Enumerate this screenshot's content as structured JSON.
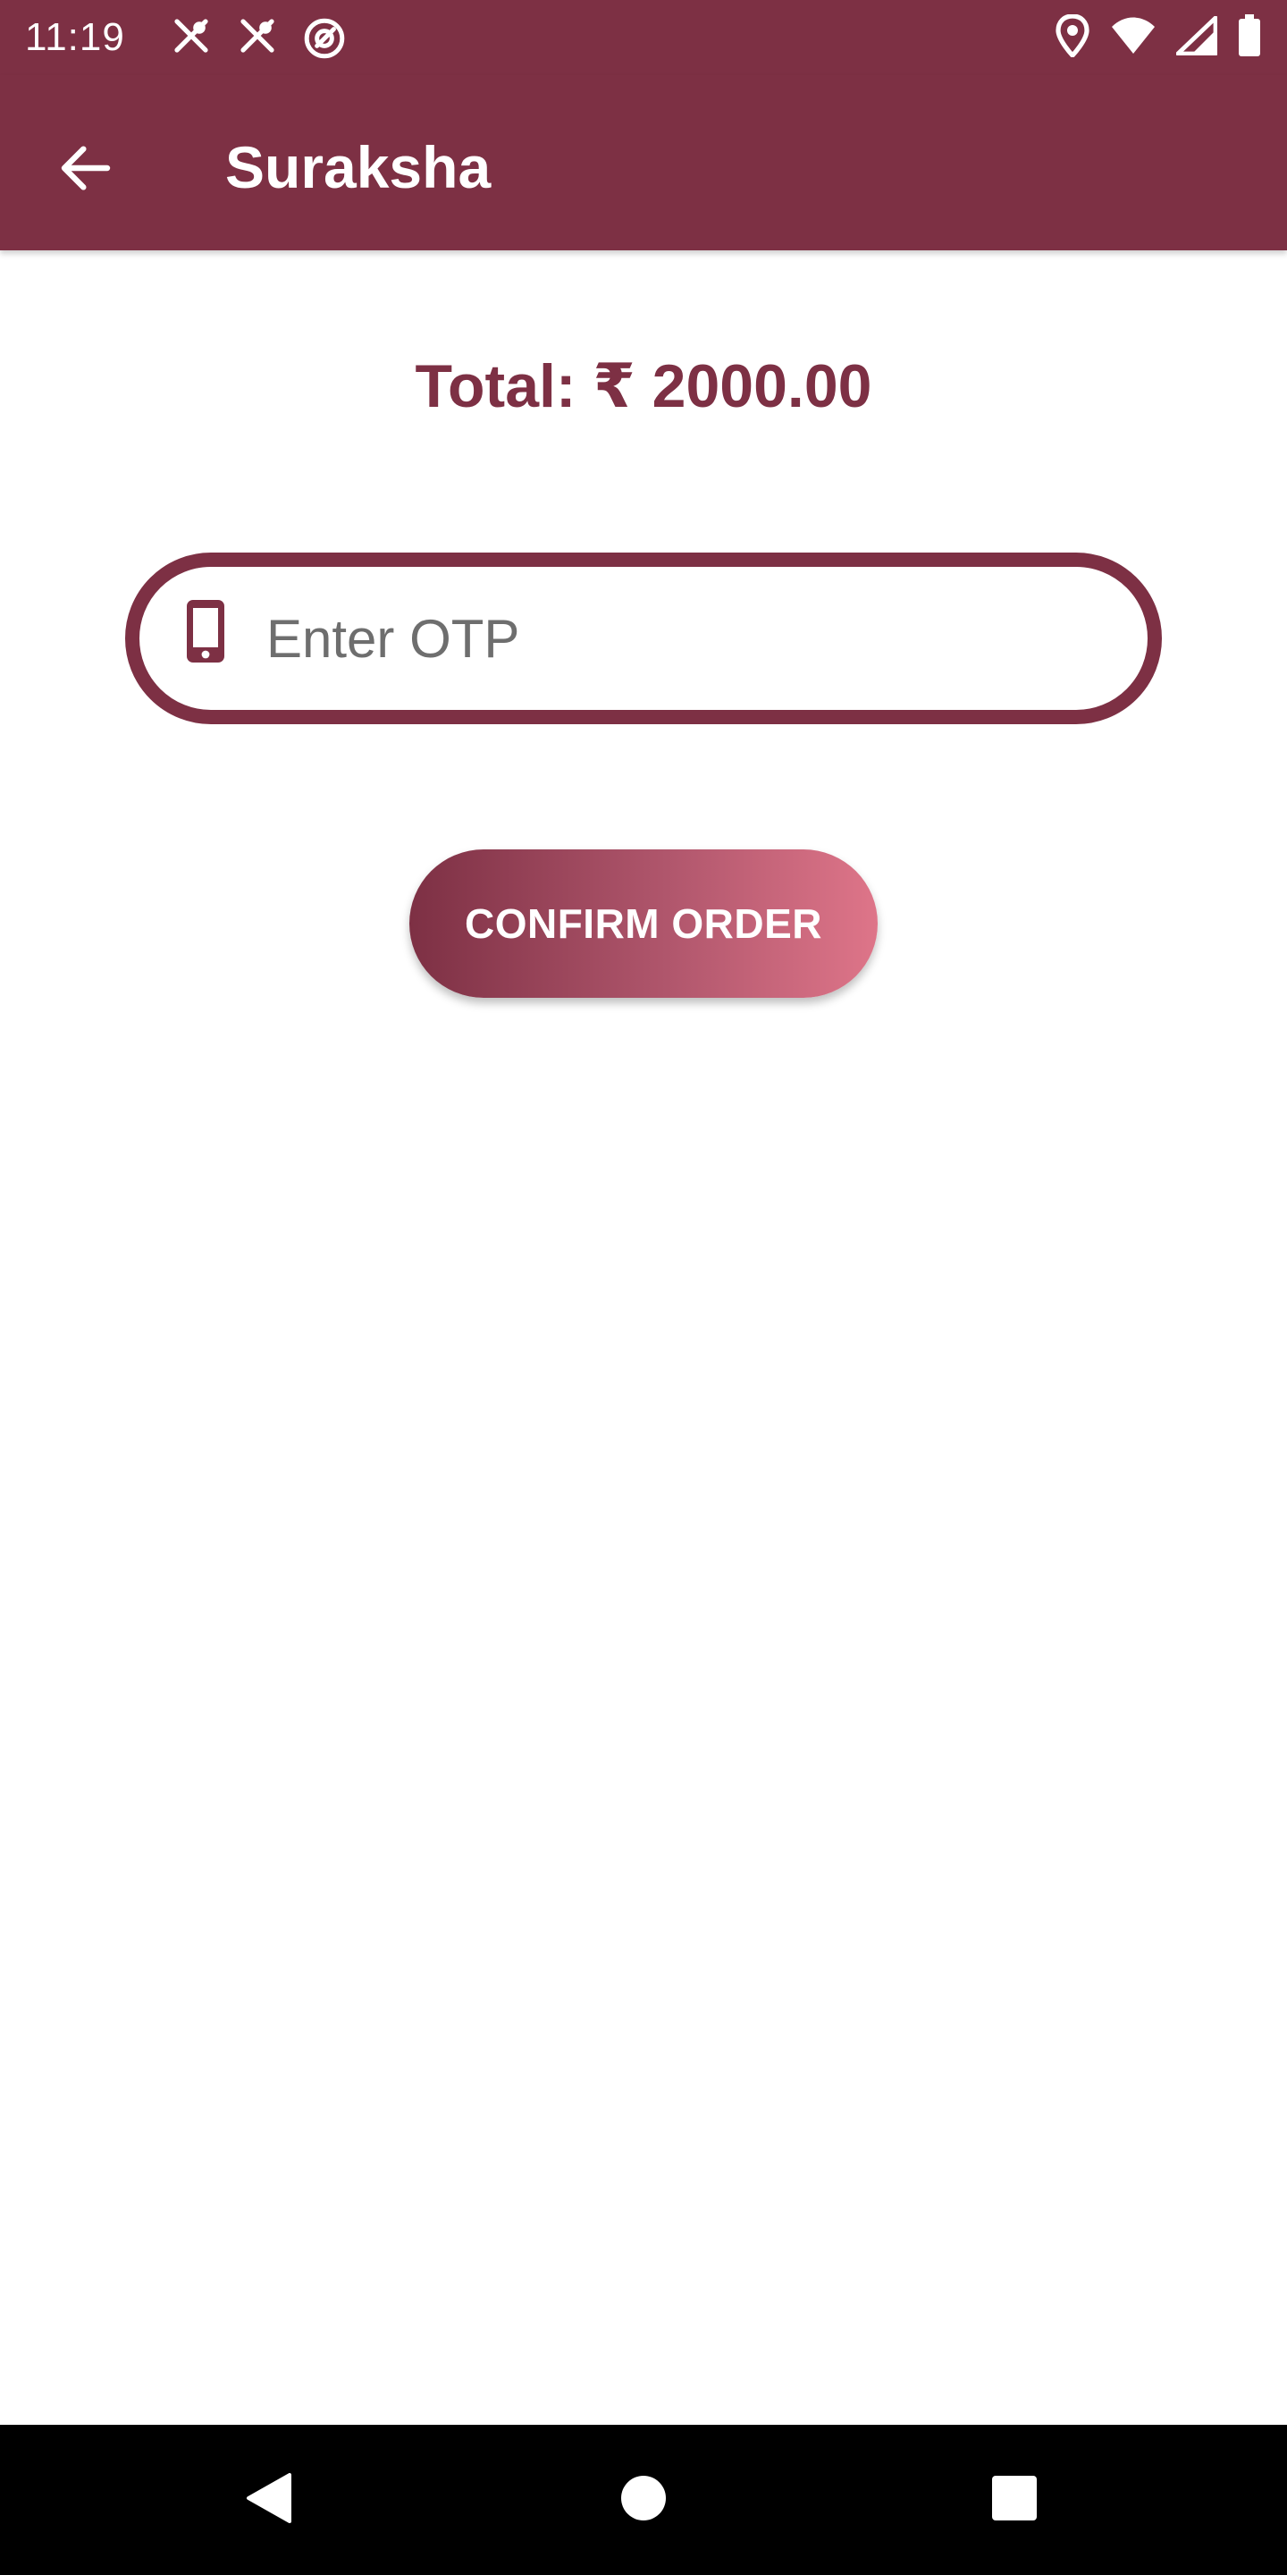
{
  "status_bar": {
    "time": "11:19",
    "left_icons": [
      "fork-knife-icon",
      "fork-knife-icon",
      "app-logo-icon"
    ],
    "right_icons": [
      "location-icon",
      "wifi-icon",
      "signal-icon",
      "battery-icon"
    ]
  },
  "app_bar": {
    "title": "Suraksha",
    "background_color": "#7d3044"
  },
  "main": {
    "total_text": "Total: ₹ 2000.00",
    "otp_field": {
      "placeholder": "Enter OTP",
      "value": ""
    },
    "confirm_label": "CONFIRM ORDER"
  },
  "colors": {
    "primary": "#7d3044",
    "gradient_end": "#de7589"
  }
}
